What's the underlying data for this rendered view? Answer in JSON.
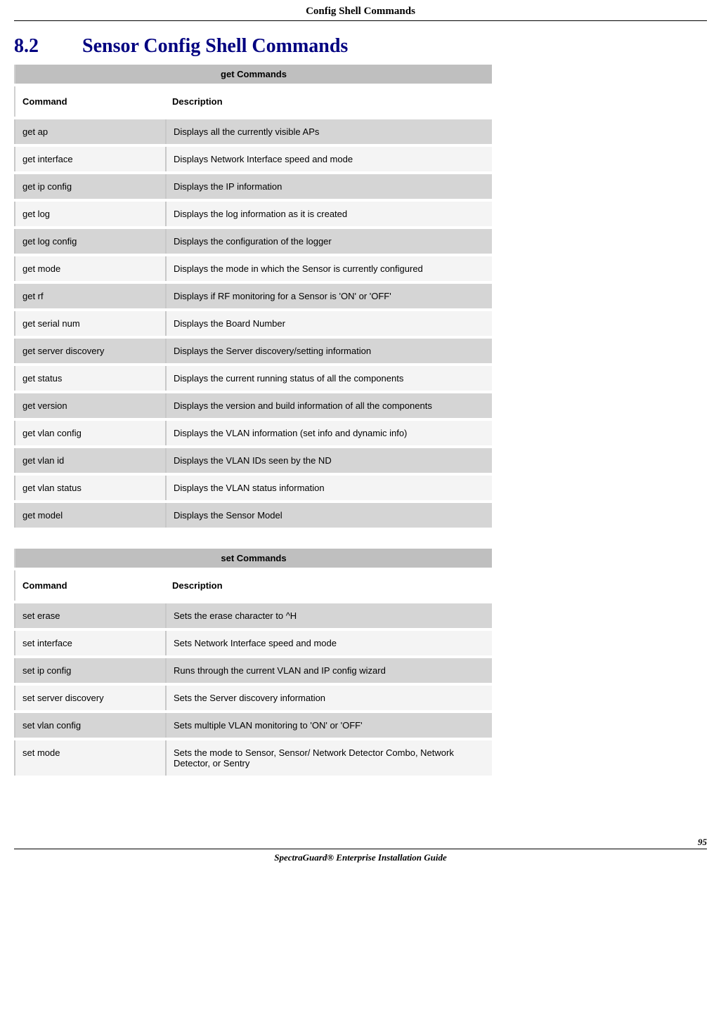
{
  "header": {
    "title": "Config Shell Commands"
  },
  "section": {
    "number": "8.2",
    "title": "Sensor Config Shell Commands"
  },
  "tables": {
    "get": {
      "title": "get Commands",
      "col1": "Command",
      "col2": "Description",
      "rows": [
        {
          "cmd": "get ap",
          "desc": "Displays all the currently visible APs"
        },
        {
          "cmd": "get interface",
          "desc": "Displays Network Interface speed and mode"
        },
        {
          "cmd": "get ip config",
          "desc": "Displays the IP information"
        },
        {
          "cmd": "get log",
          "desc": "Displays the log information as it is created"
        },
        {
          "cmd": "get log config",
          "desc": "Displays the configuration of the logger"
        },
        {
          "cmd": "get mode",
          "desc": "Displays the mode in which the Sensor is currently configured"
        },
        {
          "cmd": "get rf",
          "desc": "Displays if RF monitoring for a Sensor is 'ON' or 'OFF'"
        },
        {
          "cmd": "get serial num",
          "desc": "Displays the Board Number"
        },
        {
          "cmd": "get server discovery",
          "desc": "Displays the Server discovery/setting information"
        },
        {
          "cmd": "get status",
          "desc": "Displays the current running status of all the components"
        },
        {
          "cmd": "get version",
          "desc": "Displays the version and build information of all the components"
        },
        {
          "cmd": "get vlan config",
          "desc": "Displays the VLAN information (set info and dynamic info)"
        },
        {
          "cmd": "get vlan id",
          "desc": "Displays the VLAN IDs seen by the ND"
        },
        {
          "cmd": "get vlan status",
          "desc": "Displays the VLAN status information"
        },
        {
          "cmd": "get model",
          "desc": "Displays the Sensor Model"
        }
      ]
    },
    "set": {
      "title": "set Commands",
      "col1": "Command",
      "col2": "Description",
      "rows": [
        {
          "cmd": "set erase",
          "desc": "Sets the erase character to ^H"
        },
        {
          "cmd": "set interface",
          "desc": "Sets Network Interface speed and mode"
        },
        {
          "cmd": "set ip config",
          "desc": "Runs through the current VLAN and IP config wizard"
        },
        {
          "cmd": "set server discovery",
          "desc": "Sets the Server discovery information"
        },
        {
          "cmd": "set vlan config",
          "desc": "Sets multiple VLAN monitoring to 'ON' or 'OFF'"
        },
        {
          "cmd": "set mode",
          "desc": "Sets the mode to Sensor, Sensor/ Network Detector Combo, Network Detector, or Sentry"
        }
      ]
    }
  },
  "footer": {
    "text": "SpectraGuard® Enterprise Installation Guide",
    "page": "95"
  }
}
